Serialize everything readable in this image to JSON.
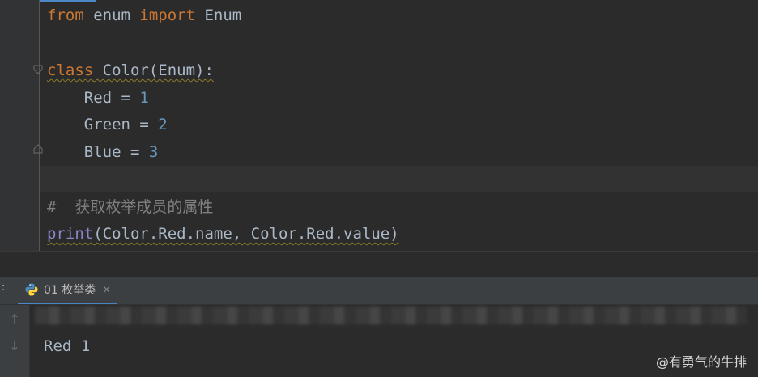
{
  "editor": {
    "lines": {
      "l1": {
        "kw1": "from",
        "t1": " enum ",
        "kw2": "import",
        "t2": " Enum"
      },
      "l2": {
        "kw": "class",
        "t": " Color(Enum):"
      },
      "l3": {
        "name": "    Red = ",
        "num": "1"
      },
      "l4": {
        "name": "    Green = ",
        "num": "2"
      },
      "l5": {
        "name": "    Blue = ",
        "num": "3"
      },
      "l6": {
        "comment": "#  获取枚举成员的属性"
      },
      "l7": {
        "fn": "print",
        "args": "(Color.Red.name, Color.Red.value)"
      }
    }
  },
  "run_panel": {
    "colon_label": ":",
    "tab": {
      "label": "01 枚举类",
      "close": "×"
    },
    "toolbar": {
      "up": "↑",
      "down": "↓"
    },
    "output": "Red 1"
  },
  "watermark": "@有勇气的牛排",
  "colors": {
    "keyword": "#cc7832",
    "number": "#6897bb",
    "comment": "#808080",
    "builtin": "#8888c6",
    "text": "#a9b7c6",
    "accent": "#4a88c7"
  }
}
